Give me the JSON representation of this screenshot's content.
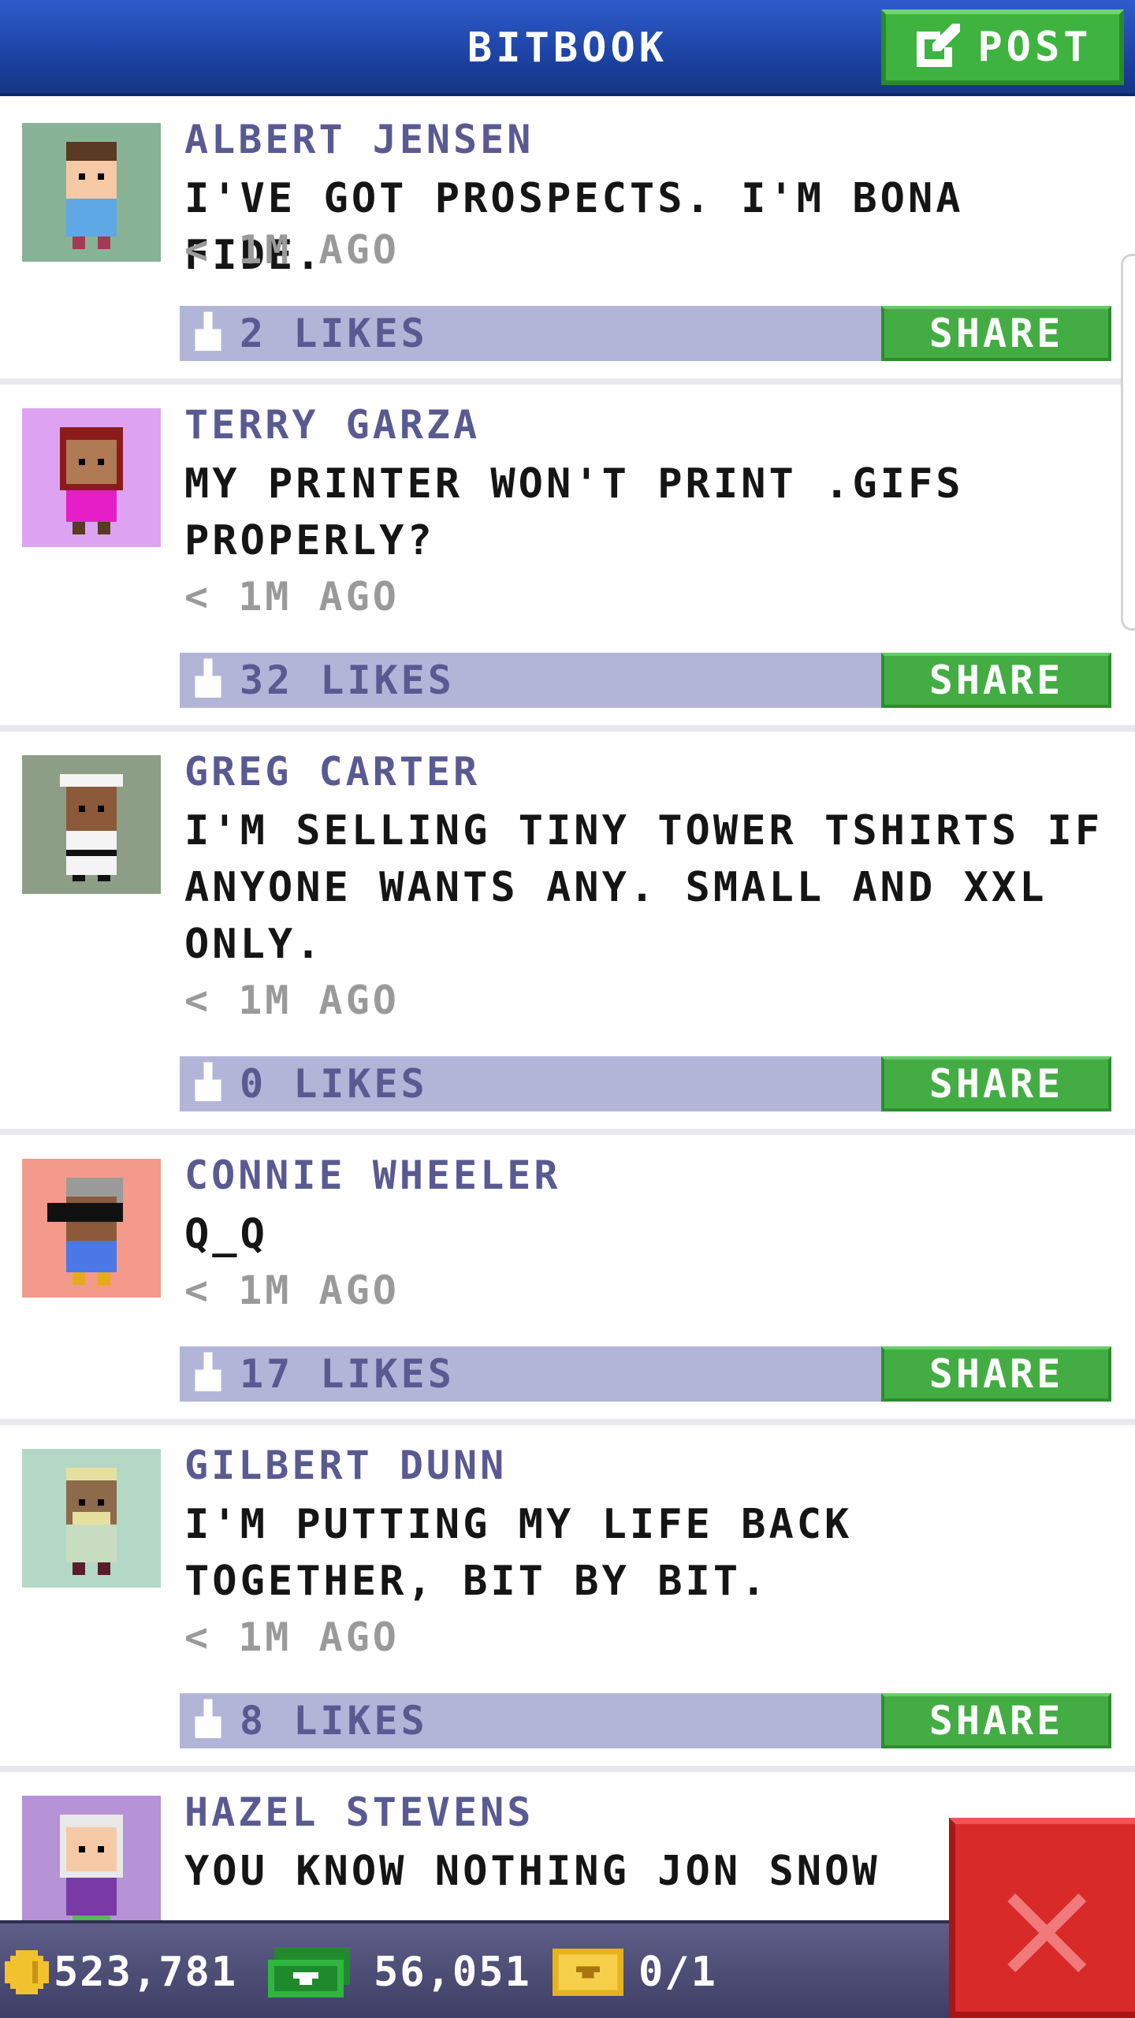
{
  "header": {
    "title": "BITBOOK",
    "post_label": "POST"
  },
  "posts": [
    {
      "author": "ALBERT JENSEN",
      "message": "I'VE GOT PROSPECTS. I'M BONA FIDE.",
      "time": "< 1M AGO",
      "likes": "2 LIKES",
      "share_label": "SHARE",
      "avatar_bg": "#88b396"
    },
    {
      "author": "TERRY GARZA",
      "message": "MY PRINTER WON'T PRINT .GIFS PROPERLY?",
      "time": "< 1M AGO",
      "likes": "32 LIKES",
      "share_label": "SHARE",
      "avatar_bg": "#dda2f2"
    },
    {
      "author": "GREG CARTER",
      "message": "I'M SELLING TINY TOWER TSHIRTS IF ANYONE WANTS ANY. SMALL AND XXL ONLY.",
      "time": "< 1M AGO",
      "likes": "0 LIKES",
      "share_label": "SHARE",
      "avatar_bg": "#8c9e86"
    },
    {
      "author": "CONNIE WHEELER",
      "message": "Q_Q",
      "time": "< 1M AGO",
      "likes": "17 LIKES",
      "share_label": "SHARE",
      "avatar_bg": "#f39a8a"
    },
    {
      "author": "GILBERT DUNN",
      "message": "I'M PUTTING MY LIFE BACK TOGETHER, BIT BY BIT.",
      "time": "< 1M AGO",
      "likes": "8 LIKES",
      "share_label": "SHARE",
      "avatar_bg": "#b4d8c6"
    },
    {
      "author": "HAZEL STEVENS",
      "message": "YOU KNOW NOTHING JON SNOW",
      "avatar_bg": "#b692d6"
    }
  ],
  "footer": {
    "coins": "523,781",
    "bux": "56,051",
    "tickets": "0/1"
  },
  "icons": {
    "post": "edit-icon",
    "like": "thumbs-up-icon",
    "coins": "coin-icon",
    "bux": "bux-icon",
    "tickets": "ticket-icon",
    "close": "close-icon"
  },
  "colors": {
    "header": "#1a3f9c",
    "share": "#43ad43",
    "likes_bar": "#b3b5d8",
    "name": "#5a5a92",
    "close": "#d92a2a"
  }
}
